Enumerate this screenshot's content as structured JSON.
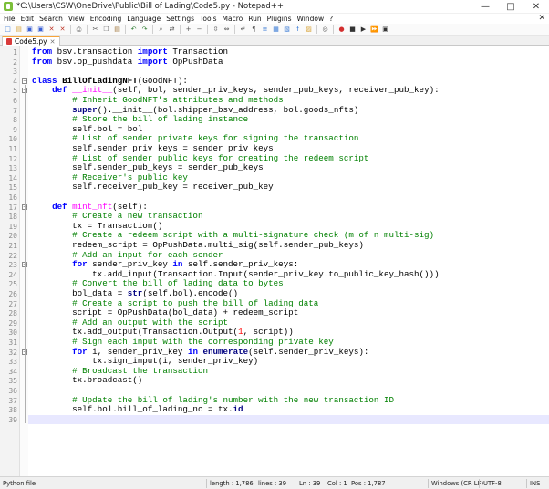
{
  "window": {
    "title": "*C:\\Users\\CSW\\OneDrive\\Public\\Bill of Lading\\Code5.py - Notepad++",
    "controls": [
      "—",
      "□",
      "✕"
    ]
  },
  "menu": [
    "File",
    "Edit",
    "Search",
    "View",
    "Encoding",
    "Language",
    "Settings",
    "Tools",
    "Macro",
    "Run",
    "Plugins",
    "Window",
    "?"
  ],
  "menu_close": "✕",
  "toolbar_icons": [
    {
      "name": "new-file-icon",
      "glyph": "□",
      "color": "#3a7bd5"
    },
    {
      "name": "open-file-icon",
      "glyph": "▤",
      "color": "#d9a53a"
    },
    {
      "name": "save-icon",
      "glyph": "▣",
      "color": "#3a5fd5"
    },
    {
      "name": "save-all-icon",
      "glyph": "▣",
      "color": "#3a5fd5"
    },
    {
      "name": "close-icon",
      "glyph": "✕",
      "color": "#c0392b"
    },
    {
      "name": "close-all-icon",
      "glyph": "✕",
      "color": "#c0392b"
    },
    {
      "name": "print-icon",
      "glyph": "⎙",
      "color": "#555555"
    },
    {
      "name": "cut-icon",
      "glyph": "✂",
      "color": "#555555"
    },
    {
      "name": "copy-icon",
      "glyph": "❐",
      "color": "#555555"
    },
    {
      "name": "paste-icon",
      "glyph": "▤",
      "color": "#a0763a"
    },
    {
      "name": "undo-icon",
      "glyph": "↶",
      "color": "#2e7d32"
    },
    {
      "name": "redo-icon",
      "glyph": "↷",
      "color": "#2e7d32"
    },
    {
      "name": "find-icon",
      "glyph": "⌕",
      "color": "#555555"
    },
    {
      "name": "replace-icon",
      "glyph": "⇄",
      "color": "#555555"
    },
    {
      "name": "zoom-in-icon",
      "glyph": "+",
      "color": "#555555"
    },
    {
      "name": "zoom-out-icon",
      "glyph": "−",
      "color": "#555555"
    },
    {
      "name": "sync-v-icon",
      "glyph": "⇳",
      "color": "#555555"
    },
    {
      "name": "sync-h-icon",
      "glyph": "⇔",
      "color": "#555555"
    },
    {
      "name": "word-wrap-icon",
      "glyph": "↵",
      "color": "#555555"
    },
    {
      "name": "show-all-icon",
      "glyph": "¶",
      "color": "#555555"
    },
    {
      "name": "indent-guide-icon",
      "glyph": "≡",
      "color": "#3a7bd5"
    },
    {
      "name": "lang-icon",
      "glyph": "▦",
      "color": "#3a7bd5"
    },
    {
      "name": "doc-map-icon",
      "glyph": "▧",
      "color": "#3a7bd5"
    },
    {
      "name": "func-list-icon",
      "glyph": "f",
      "color": "#3a7bd5"
    },
    {
      "name": "folder-workspace-icon",
      "glyph": "▨",
      "color": "#d9a53a"
    },
    {
      "name": "monitor-icon",
      "glyph": "◎",
      "color": "#555555"
    },
    {
      "name": "record-macro-icon",
      "glyph": "●",
      "color": "#d32f2f"
    },
    {
      "name": "stop-macro-icon",
      "glyph": "■",
      "color": "#333333"
    },
    {
      "name": "play-macro-icon",
      "glyph": "▶",
      "color": "#333333"
    },
    {
      "name": "play-multiple-icon",
      "glyph": "⏩",
      "color": "#333333"
    },
    {
      "name": "save-macro-icon",
      "glyph": "▣",
      "color": "#333333"
    }
  ],
  "tab": {
    "label": "Code5.py",
    "close": "✕"
  },
  "code": {
    "current_line": 38,
    "lines": [
      {
        "n": "1",
        "tokens": [
          [
            "kw",
            "from"
          ],
          [
            "id",
            " bsv.transaction "
          ],
          [
            "kw",
            "import"
          ],
          [
            "id",
            " Transaction"
          ]
        ]
      },
      {
        "n": "2",
        "tokens": [
          [
            "kw",
            "from"
          ],
          [
            "id",
            " bsv.op_pushdata "
          ],
          [
            "kw",
            "import"
          ],
          [
            "id",
            " OpPushData"
          ]
        ]
      },
      {
        "n": "3",
        "tokens": []
      },
      {
        "n": "4",
        "tokens": [
          [
            "kw",
            "class"
          ],
          [
            "id",
            " "
          ],
          [
            "cls",
            "BillOfLadingNFT"
          ],
          [
            "id",
            "(GoodNFT):"
          ]
        ]
      },
      {
        "n": "5",
        "tokens": [
          [
            "id",
            "    "
          ],
          [
            "kw",
            "def"
          ],
          [
            "id",
            " "
          ],
          [
            "fn",
            "__init__"
          ],
          [
            "id",
            "(self, bol, sender_priv_keys, sender_pub_keys, receiver_pub_key):"
          ]
        ]
      },
      {
        "n": "6",
        "tokens": [
          [
            "id",
            "        "
          ],
          [
            "cm",
            "# Inherit GoodNFT's attributes and methods"
          ]
        ]
      },
      {
        "n": "7",
        "tokens": [
          [
            "id",
            "        "
          ],
          [
            "kw2",
            "super"
          ],
          [
            "id",
            "().__init__(bol.shipper_bsv_address, bol.goods_nfts)"
          ]
        ]
      },
      {
        "n": "8",
        "tokens": [
          [
            "id",
            "        "
          ],
          [
            "cm",
            "# Store the bill of lading instance"
          ]
        ]
      },
      {
        "n": "9",
        "tokens": [
          [
            "id",
            "        self.bol = bol"
          ]
        ]
      },
      {
        "n": "10",
        "tokens": [
          [
            "id",
            "        "
          ],
          [
            "cm",
            "# List of sender private keys for signing the transaction"
          ]
        ]
      },
      {
        "n": "11",
        "tokens": [
          [
            "id",
            "        self.sender_priv_keys = sender_priv_keys"
          ]
        ]
      },
      {
        "n": "12",
        "tokens": [
          [
            "id",
            "        "
          ],
          [
            "cm",
            "# List of sender public keys for creating the redeem script"
          ]
        ]
      },
      {
        "n": "13",
        "tokens": [
          [
            "id",
            "        self.sender_pub_keys = sender_pub_keys"
          ]
        ]
      },
      {
        "n": "14",
        "tokens": [
          [
            "id",
            "        "
          ],
          [
            "cm",
            "# Receiver's public key"
          ]
        ]
      },
      {
        "n": "15",
        "tokens": [
          [
            "id",
            "        self.receiver_pub_key = receiver_pub_key"
          ]
        ]
      },
      {
        "n": "16",
        "tokens": []
      },
      {
        "n": "17",
        "tokens": [
          [
            "id",
            "    "
          ],
          [
            "kw",
            "def"
          ],
          [
            "id",
            " "
          ],
          [
            "fn",
            "mint_nft"
          ],
          [
            "id",
            "(self):"
          ]
        ]
      },
      {
        "n": "18",
        "tokens": [
          [
            "id",
            "        "
          ],
          [
            "cm",
            "# Create a new transaction"
          ]
        ]
      },
      {
        "n": "19",
        "tokens": [
          [
            "id",
            "        tx = Transaction()"
          ]
        ]
      },
      {
        "n": "20",
        "tokens": [
          [
            "id",
            "        "
          ],
          [
            "cm",
            "# Create a redeem script with a multi-signature check (m of n multi-sig)"
          ]
        ]
      },
      {
        "n": "21",
        "tokens": [
          [
            "id",
            "        redeem_script = OpPushData.multi_sig(self.sender_pub_keys)"
          ]
        ]
      },
      {
        "n": "22",
        "tokens": [
          [
            "id",
            "        "
          ],
          [
            "cm",
            "# Add an input for each sender"
          ]
        ]
      },
      {
        "n": "23",
        "tokens": [
          [
            "id",
            "        "
          ],
          [
            "kw",
            "for"
          ],
          [
            "id",
            " sender_priv_key "
          ],
          [
            "kw",
            "in"
          ],
          [
            "id",
            " self.sender_priv_keys:"
          ]
        ]
      },
      {
        "n": "24",
        "tokens": [
          [
            "id",
            "            tx.add_input(Transaction.Input(sender_priv_key.to_public_key_hash()))"
          ]
        ]
      },
      {
        "n": "25",
        "tokens": [
          [
            "id",
            "        "
          ],
          [
            "cm",
            "# Convert the bill of lading data to bytes"
          ]
        ]
      },
      {
        "n": "26",
        "tokens": [
          [
            "id",
            "        bol_data = "
          ],
          [
            "kw2",
            "str"
          ],
          [
            "id",
            "(self.bol).encode()"
          ]
        ]
      },
      {
        "n": "27",
        "tokens": [
          [
            "id",
            "        "
          ],
          [
            "cm",
            "# Create a script to push the bill of lading data"
          ]
        ]
      },
      {
        "n": "28",
        "tokens": [
          [
            "id",
            "        script = OpPushData(bol_data) + redeem_script"
          ]
        ]
      },
      {
        "n": "29",
        "tokens": [
          [
            "id",
            "        "
          ],
          [
            "cm",
            "# Add an output with the script"
          ]
        ]
      },
      {
        "n": "30",
        "tokens": [
          [
            "id",
            "        tx.add_output(Transaction.Output("
          ],
          [
            "num",
            "1"
          ],
          [
            "id",
            ", script))"
          ]
        ]
      },
      {
        "n": "31",
        "tokens": [
          [
            "id",
            "        "
          ],
          [
            "cm",
            "# Sign each input with the corresponding private key"
          ]
        ]
      },
      {
        "n": "32",
        "tokens": [
          [
            "id",
            "        "
          ],
          [
            "kw",
            "for"
          ],
          [
            "id",
            " i, sender_priv_key "
          ],
          [
            "kw",
            "in"
          ],
          [
            "id",
            " "
          ],
          [
            "kw2",
            "enumerate"
          ],
          [
            "id",
            "(self.sender_priv_keys):"
          ]
        ]
      },
      {
        "n": "33",
        "tokens": [
          [
            "id",
            "            tx.sign_input(i, sender_priv_key)"
          ]
        ]
      },
      {
        "n": "34",
        "tokens": [
          [
            "id",
            "        "
          ],
          [
            "cm",
            "# Broadcast the transaction"
          ]
        ]
      },
      {
        "n": "35",
        "tokens": [
          [
            "id",
            "        tx.broadcast()"
          ]
        ]
      },
      {
        "n": "36",
        "tokens": []
      },
      {
        "n": "37",
        "tokens": [
          [
            "id",
            "        "
          ],
          [
            "cm",
            "# Update the bill of lading's number with the new transaction ID"
          ]
        ]
      },
      {
        "n": "38",
        "tokens": [
          [
            "id",
            "        self.bol.bill_of_lading_no = tx."
          ],
          [
            "kw2",
            "id"
          ]
        ]
      },
      {
        "n": "39",
        "tokens": []
      }
    ]
  },
  "status": {
    "file_type": "Python file",
    "length": "length : 1,786",
    "lines": "lines : 39",
    "ln": "Ln : 39",
    "col": "Col : 1",
    "pos": "Pos : 1,787",
    "eol": "Windows (CR LF)",
    "encoding": "UTF-8",
    "mode": "INS"
  }
}
